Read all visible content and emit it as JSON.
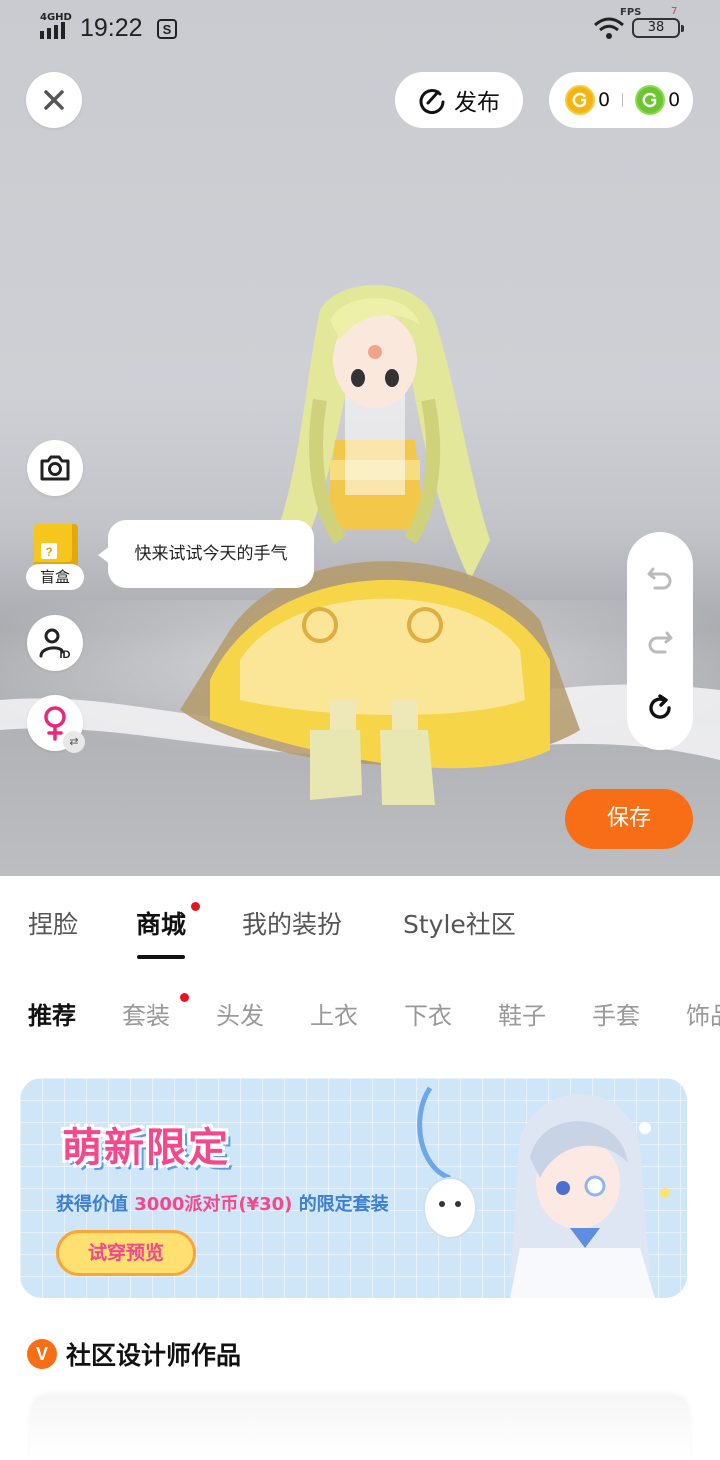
{
  "status_bar": {
    "network": "4GHD",
    "time": "19:22",
    "fps_label": "FPS",
    "fps_value": "7",
    "battery": "38"
  },
  "top_bar": {
    "publish_label": "发布",
    "gold_coins": "0",
    "green_coins": "0"
  },
  "side_tools": {
    "blindbox_label": "盲盒",
    "bubble_text": "快来试试今天的手气"
  },
  "save_label": "保存",
  "main_tabs": [
    {
      "label": "捏脸",
      "active": false
    },
    {
      "label": "商城",
      "active": true,
      "dot": true
    },
    {
      "label": "我的装扮",
      "active": false
    },
    {
      "label": "Style社区",
      "active": false
    }
  ],
  "sub_tabs": [
    {
      "label": "推荐",
      "active": true
    },
    {
      "label": "套装",
      "dot": true
    },
    {
      "label": "头发"
    },
    {
      "label": "上衣"
    },
    {
      "label": "下衣"
    },
    {
      "label": "鞋子"
    },
    {
      "label": "手套"
    },
    {
      "label": "饰品"
    }
  ],
  "banner": {
    "title": "萌新限定",
    "subtitle_pre": "获得价值",
    "subtitle_highlight": "3000派对币(¥30)",
    "subtitle_post": "的限定套装",
    "button": "试穿预览"
  },
  "section": {
    "badge": "V",
    "title": "社区设计师作品"
  },
  "colors": {
    "accent_orange": "#f86e17",
    "notification_red": "#e5141f",
    "banner_pink": "#f5488c",
    "banner_blue": "#3f7fcf"
  }
}
